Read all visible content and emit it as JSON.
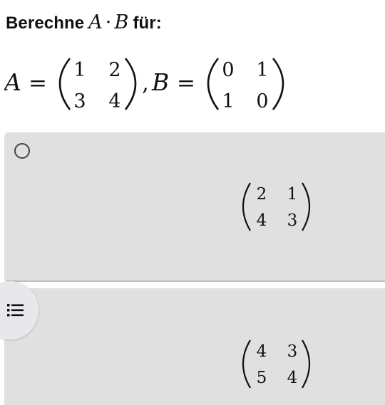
{
  "question": {
    "prefix": "Berechne",
    "var_a": "A",
    "dot": "·",
    "var_b": "B",
    "suffix": "für:"
  },
  "equation": {
    "lhs_a": "A",
    "equals_a": "=",
    "matrix_a": [
      [
        "1",
        "2"
      ],
      [
        "3",
        "4"
      ]
    ],
    "separator": ",",
    "lhs_b": "B",
    "equals_b": "=",
    "matrix_b": [
      [
        "0",
        "1"
      ],
      [
        "1",
        "0"
      ]
    ]
  },
  "options": [
    {
      "matrix": [
        [
          "2",
          "1"
        ],
        [
          "4",
          "3"
        ]
      ],
      "selected": false
    },
    {
      "matrix": [
        [
          "4",
          "3"
        ],
        [
          "5",
          "4"
        ]
      ],
      "selected": false
    }
  ],
  "icons": {
    "radio": "radio-unchecked-icon",
    "list": "list-icon"
  },
  "colors": {
    "option_background": "#e0e0e0",
    "option_border": "#bdbdbd",
    "radio_stroke": "#444444",
    "fab_background": "#e8e8ec",
    "text": "#111111"
  }
}
